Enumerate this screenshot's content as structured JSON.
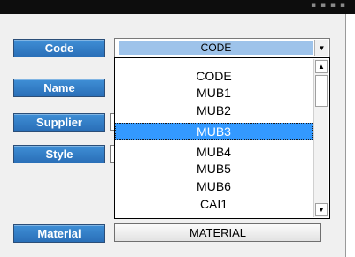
{
  "form": {
    "labels": {
      "code": "Code",
      "name": "Name",
      "supplier": "Supplier",
      "style": "Style",
      "material": "Material"
    },
    "code_combo": {
      "value": "CODE",
      "dropdown_arrow": "▼"
    },
    "code_options": [
      "CODE",
      "MUB1",
      "MUB2",
      "MUB3",
      "MUB4",
      "MUB5",
      "MUB6",
      "CAI1"
    ],
    "selected_option": "MUB3",
    "material_value": "MATERIAL",
    "scroll_up_glyph": "▲",
    "scroll_down_glyph": "▼"
  },
  "colors": {
    "label_button": "#2f7cc8",
    "selection": "#3399ff",
    "combo_highlight": "#9ec3ea"
  }
}
